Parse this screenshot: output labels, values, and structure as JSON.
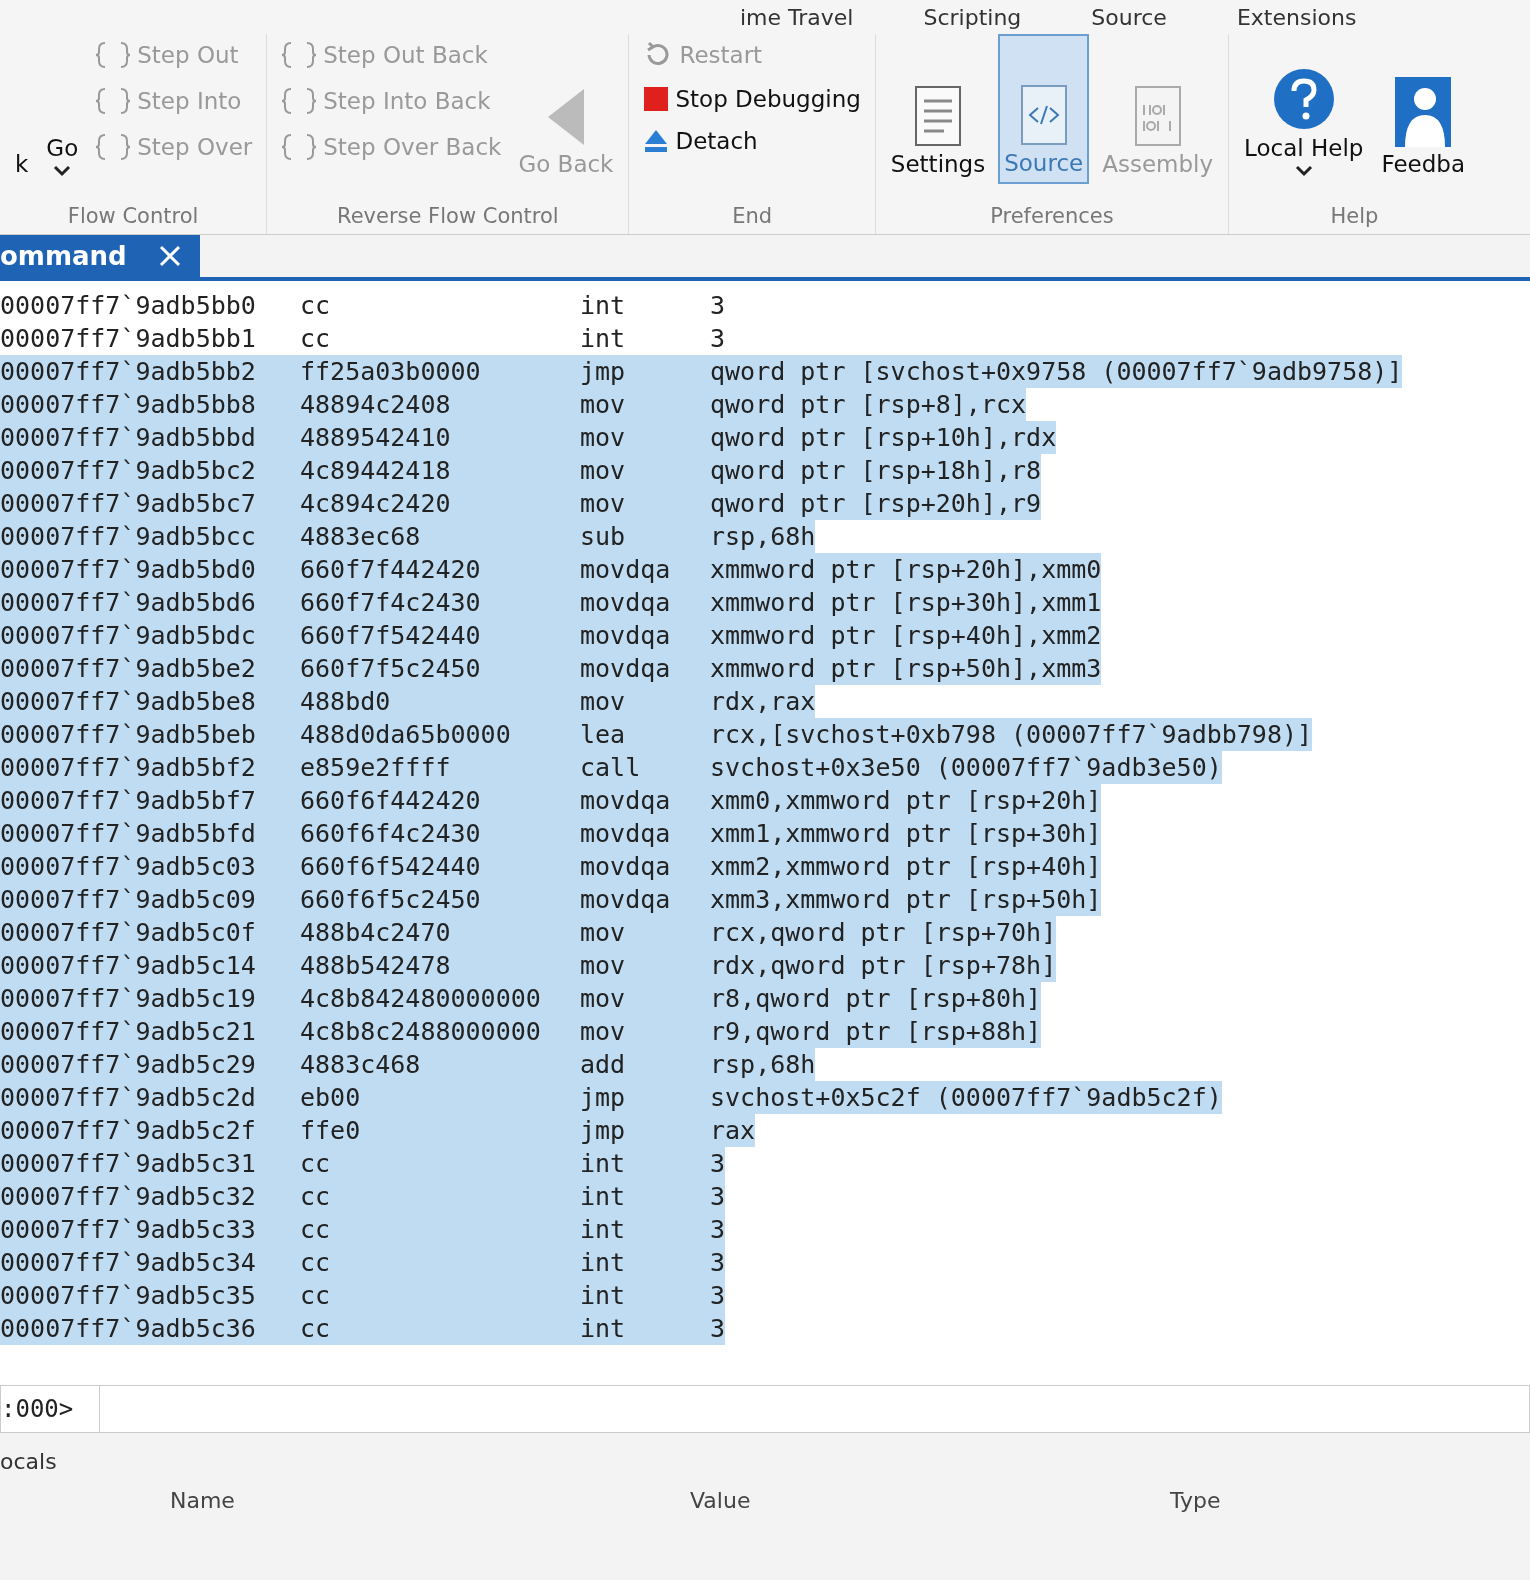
{
  "ribbon": {
    "tabs": [
      {
        "label": "ime Travel"
      },
      {
        "label": "Scripting"
      },
      {
        "label": "Source"
      },
      {
        "label": "Extensions"
      }
    ],
    "groups": [
      {
        "label": "Flow Control",
        "buttons": [
          {
            "label": "k",
            "kind": "text",
            "disabled": false,
            "selected": false
          },
          {
            "label": "Go",
            "kind": "dropdown",
            "disabled": false,
            "selected": false
          },
          {
            "label": "Step Out",
            "kind": "braces",
            "disabled": true,
            "selected": false
          },
          {
            "label": "Step Into",
            "kind": "braces",
            "disabled": true,
            "selected": false
          },
          {
            "label": "Step Over",
            "kind": "braces",
            "disabled": true,
            "selected": false
          }
        ]
      },
      {
        "label": "Reverse Flow Control",
        "buttons": [
          {
            "label": "Step Out Back",
            "kind": "braces",
            "disabled": true,
            "selected": false
          },
          {
            "label": "Step Into Back",
            "kind": "braces",
            "disabled": true,
            "selected": false
          },
          {
            "label": "Step Over Back",
            "kind": "braces",
            "disabled": true,
            "selected": false
          },
          {
            "label": "Go Back",
            "kind": "back",
            "disabled": true,
            "selected": false
          }
        ]
      },
      {
        "label": "End",
        "buttons": [
          {
            "label": "Restart",
            "kind": "restart",
            "disabled": true,
            "selected": false
          },
          {
            "label": "Stop Debugging",
            "kind": "stop",
            "disabled": false,
            "selected": false
          },
          {
            "label": "Detach",
            "kind": "eject",
            "disabled": false,
            "selected": false
          }
        ]
      },
      {
        "label": "Preferences",
        "buttons": [
          {
            "label": "Settings",
            "kind": "document",
            "disabled": false,
            "selected": false
          },
          {
            "label": "Source",
            "kind": "code",
            "disabled": false,
            "selected": true
          },
          {
            "label": "Assembly",
            "kind": "binary",
            "disabled": true,
            "selected": false
          }
        ]
      },
      {
        "label": "Help",
        "buttons": [
          {
            "label": "Local Help",
            "kind": "help",
            "disabled": false,
            "selected": false
          },
          {
            "label": "Feedba",
            "kind": "person",
            "disabled": false,
            "selected": false
          }
        ]
      }
    ]
  },
  "command_window": {
    "tab": {
      "label": "ommand"
    },
    "rows": [
      {
        "address": "00007ff7`9adb5bb0",
        "bytes": "cc",
        "mnemonic": "int",
        "operands": "3",
        "selected": false
      },
      {
        "address": "00007ff7`9adb5bb1",
        "bytes": "cc",
        "mnemonic": "int",
        "operands": "3",
        "selected": false
      },
      {
        "address": "00007ff7`9adb5bb2",
        "bytes": "ff25a03b0000",
        "mnemonic": "jmp",
        "operands": "qword ptr [svchost+0x9758 (00007ff7`9adb9758)]",
        "selected": true
      },
      {
        "address": "00007ff7`9adb5bb8",
        "bytes": "48894c2408",
        "mnemonic": "mov",
        "operands": "qword ptr [rsp+8],rcx",
        "selected": true
      },
      {
        "address": "00007ff7`9adb5bbd",
        "bytes": "4889542410",
        "mnemonic": "mov",
        "operands": "qword ptr [rsp+10h],rdx",
        "selected": true
      },
      {
        "address": "00007ff7`9adb5bc2",
        "bytes": "4c89442418",
        "mnemonic": "mov",
        "operands": "qword ptr [rsp+18h],r8",
        "selected": true
      },
      {
        "address": "00007ff7`9adb5bc7",
        "bytes": "4c894c2420",
        "mnemonic": "mov",
        "operands": "qword ptr [rsp+20h],r9",
        "selected": true
      },
      {
        "address": "00007ff7`9adb5bcc",
        "bytes": "4883ec68",
        "mnemonic": "sub",
        "operands": "rsp,68h",
        "selected": true
      },
      {
        "address": "00007ff7`9adb5bd0",
        "bytes": "660f7f442420",
        "mnemonic": "movdqa",
        "operands": "xmmword ptr [rsp+20h],xmm0",
        "selected": true
      },
      {
        "address": "00007ff7`9adb5bd6",
        "bytes": "660f7f4c2430",
        "mnemonic": "movdqa",
        "operands": "xmmword ptr [rsp+30h],xmm1",
        "selected": true
      },
      {
        "address": "00007ff7`9adb5bdc",
        "bytes": "660f7f542440",
        "mnemonic": "movdqa",
        "operands": "xmmword ptr [rsp+40h],xmm2",
        "selected": true
      },
      {
        "address": "00007ff7`9adb5be2",
        "bytes": "660f7f5c2450",
        "mnemonic": "movdqa",
        "operands": "xmmword ptr [rsp+50h],xmm3",
        "selected": true
      },
      {
        "address": "00007ff7`9adb5be8",
        "bytes": "488bd0",
        "mnemonic": "mov",
        "operands": "rdx,rax",
        "selected": true
      },
      {
        "address": "00007ff7`9adb5beb",
        "bytes": "488d0da65b0000",
        "mnemonic": "lea",
        "operands": "rcx,[svchost+0xb798 (00007ff7`9adbb798)]",
        "selected": true
      },
      {
        "address": "00007ff7`9adb5bf2",
        "bytes": "e859e2ffff",
        "mnemonic": "call",
        "operands": "svchost+0x3e50 (00007ff7`9adb3e50)",
        "selected": true
      },
      {
        "address": "00007ff7`9adb5bf7",
        "bytes": "660f6f442420",
        "mnemonic": "movdqa",
        "operands": "xmm0,xmmword ptr [rsp+20h]",
        "selected": true
      },
      {
        "address": "00007ff7`9adb5bfd",
        "bytes": "660f6f4c2430",
        "mnemonic": "movdqa",
        "operands": "xmm1,xmmword ptr [rsp+30h]",
        "selected": true
      },
      {
        "address": "00007ff7`9adb5c03",
        "bytes": "660f6f542440",
        "mnemonic": "movdqa",
        "operands": "xmm2,xmmword ptr [rsp+40h]",
        "selected": true
      },
      {
        "address": "00007ff7`9adb5c09",
        "bytes": "660f6f5c2450",
        "mnemonic": "movdqa",
        "operands": "xmm3,xmmword ptr [rsp+50h]",
        "selected": true
      },
      {
        "address": "00007ff7`9adb5c0f",
        "bytes": "488b4c2470",
        "mnemonic": "mov",
        "operands": "rcx,qword ptr [rsp+70h]",
        "selected": true
      },
      {
        "address": "00007ff7`9adb5c14",
        "bytes": "488b542478",
        "mnemonic": "mov",
        "operands": "rdx,qword ptr [rsp+78h]",
        "selected": true
      },
      {
        "address": "00007ff7`9adb5c19",
        "bytes": "4c8b842480000000",
        "mnemonic": "mov",
        "operands": "r8,qword ptr [rsp+80h]",
        "selected": true
      },
      {
        "address": "00007ff7`9adb5c21",
        "bytes": "4c8b8c2488000000",
        "mnemonic": "mov",
        "operands": "r9,qword ptr [rsp+88h]",
        "selected": true
      },
      {
        "address": "00007ff7`9adb5c29",
        "bytes": "4883c468",
        "mnemonic": "add",
        "operands": "rsp,68h",
        "selected": true
      },
      {
        "address": "00007ff7`9adb5c2d",
        "bytes": "eb00",
        "mnemonic": "jmp",
        "operands": "svchost+0x5c2f (00007ff7`9adb5c2f)",
        "selected": true
      },
      {
        "address": "00007ff7`9adb5c2f",
        "bytes": "ffe0",
        "mnemonic": "jmp",
        "operands": "rax",
        "selected": true
      },
      {
        "address": "00007ff7`9adb5c31",
        "bytes": "cc",
        "mnemonic": "int",
        "operands": "3",
        "selected": true
      },
      {
        "address": "00007ff7`9adb5c32",
        "bytes": "cc",
        "mnemonic": "int",
        "operands": "3",
        "selected": true
      },
      {
        "address": "00007ff7`9adb5c33",
        "bytes": "cc",
        "mnemonic": "int",
        "operands": "3",
        "selected": true
      },
      {
        "address": "00007ff7`9adb5c34",
        "bytes": "cc",
        "mnemonic": "int",
        "operands": "3",
        "selected": true
      },
      {
        "address": "00007ff7`9adb5c35",
        "bytes": "cc",
        "mnemonic": "int",
        "operands": "3",
        "selected": true
      },
      {
        "address": "00007ff7`9adb5c36",
        "bytes": "cc",
        "mnemonic": "int",
        "operands": "3",
        "selected": true
      }
    ],
    "prompt": ":000>"
  },
  "locals": {
    "title": "ocals",
    "columns": [
      "Name",
      "Value",
      "Type"
    ]
  }
}
